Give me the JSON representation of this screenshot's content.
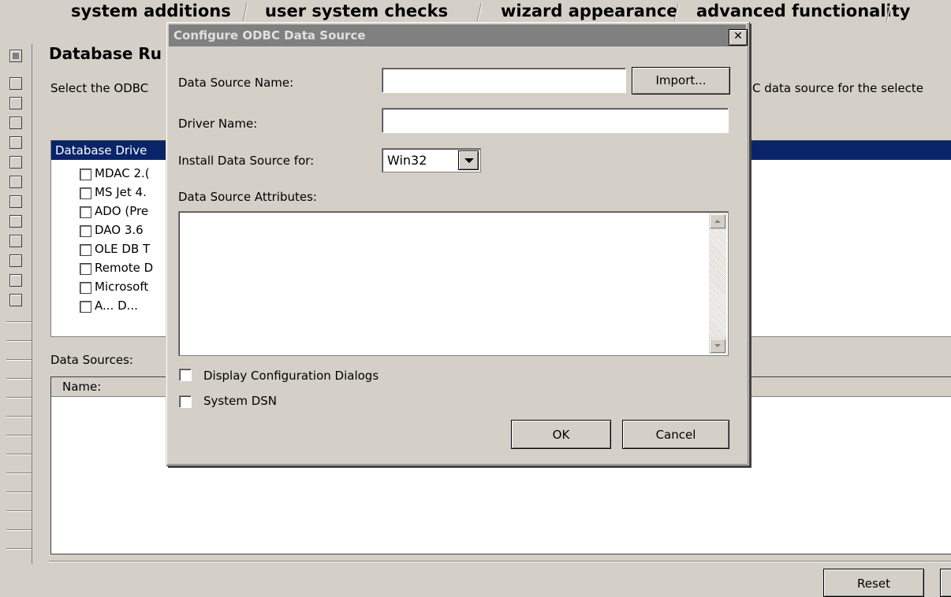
{
  "tabs": [
    "system additions",
    "user system checks",
    "wizard appearance",
    "advanced functionality"
  ],
  "main": {
    "heading": "Database Ru",
    "description_left": "Select the ODBC",
    "description_right": "BC data source for the selecte",
    "driver_header": "Database Drive",
    "drivers": [
      "MDAC 2.(",
      "MS Jet 4.",
      "ADO (Pre",
      "DAO 3.6",
      "OLE DB T",
      "Remote D",
      "Microsoft",
      "A... D..."
    ],
    "data_sources_label": "Data Sources:",
    "name_column": "Name:",
    "reset_label": "Reset"
  },
  "dialog": {
    "title": "Configure ODBC Data Source",
    "close_glyph": "✕",
    "dsn_label": "Data Source Name:",
    "dsn_value": "",
    "import_label": "Import...",
    "driver_label": "Driver Name:",
    "driver_value": "",
    "install_label": "Install Data Source for:",
    "install_value": "Win32",
    "attributes_label": "Data Source Attributes:",
    "attributes_value": "",
    "display_config_label": "Display Configuration Dialogs",
    "system_dsn_label": "System DSN",
    "ok_label": "OK",
    "cancel_label": "Cancel"
  },
  "colors": {
    "face": "#d4d0c8",
    "selection": "#0a246a",
    "inactive_title": "#808080"
  }
}
